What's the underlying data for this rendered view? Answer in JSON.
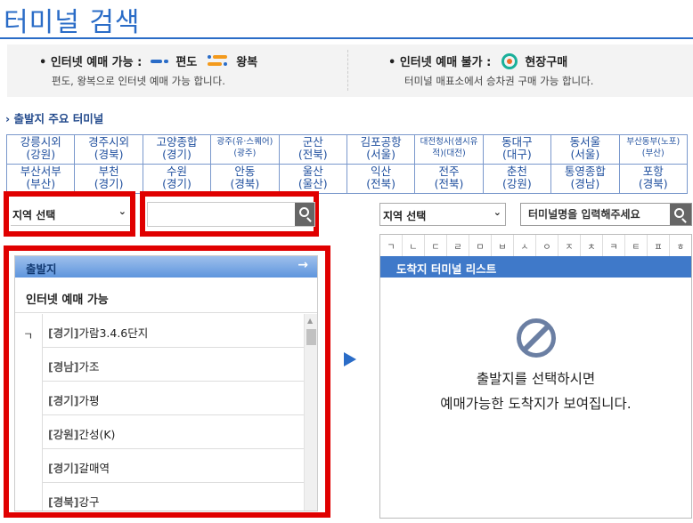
{
  "page_title": "터미널 검색",
  "legend": {
    "internet_ok": {
      "label": "• 인터넷 예매 가능 :",
      "oneway": "편도",
      "roundtrip": "왕복",
      "desc": "편도, 왕복으로 인터넷 예매 가능 합니다."
    },
    "internet_no": {
      "label": "• 인터넷 예매 불가 :",
      "onsite": "현장구매",
      "desc": "터미널 매표소에서 승차권 구매 가능 합니다."
    }
  },
  "colors": {
    "accent": "#2a6cc7",
    "oneway": "#2a6cc7",
    "roundtrip_a": "#2a6cc7",
    "roundtrip_b": "#f39a1c",
    "onsite_ring": "#1ab09a",
    "onsite_dot": "#f06b28",
    "highlight": "#e00000"
  },
  "section_title": "출발지 주요 터미널",
  "terminals": [
    [
      {
        "name": "강릉시외",
        "region": "(강원)"
      },
      {
        "name": "경주시외",
        "region": "(경북)"
      },
      {
        "name": "고양종합",
        "region": "(경기)"
      },
      {
        "name": "광주(유·스퀘어)",
        "region": "(광주)",
        "small": true
      },
      {
        "name": "군산",
        "region": "(전북)"
      },
      {
        "name": "김포공항",
        "region": "(서울)"
      },
      {
        "name": "대전청사(샘시유",
        "region": "적)(대전)",
        "small": true
      },
      {
        "name": "동대구",
        "region": "(대구)"
      },
      {
        "name": "동서울",
        "region": "(서울)"
      },
      {
        "name": "부산동부(노포)",
        "region": "(부산)",
        "small": true
      }
    ],
    [
      {
        "name": "부산서부",
        "region": "(부산)"
      },
      {
        "name": "부천",
        "region": "(경기)"
      },
      {
        "name": "수원",
        "region": "(경기)"
      },
      {
        "name": "안동",
        "region": "(경북)"
      },
      {
        "name": "울산",
        "region": "(울산)"
      },
      {
        "name": "익산",
        "region": "(전북)"
      },
      {
        "name": "전주",
        "region": "(전북)"
      },
      {
        "name": "춘천",
        "region": "(강원)"
      },
      {
        "name": "통영종합",
        "region": "(경남)"
      },
      {
        "name": "포항",
        "region": "(경북)"
      }
    ]
  ],
  "departure": {
    "region_select": "지역 선택",
    "search_value": "",
    "panel_title": "출발지",
    "panel_subtitle": "인터넷 예매 가능",
    "index_letter": "ㄱ",
    "items": [
      {
        "region": "[경기]",
        "name": "가람3.4.6단지"
      },
      {
        "region": "[경남]",
        "name": "가조"
      },
      {
        "region": "[경기]",
        "name": "가평"
      },
      {
        "region": "[강원]",
        "name": "간성(K)"
      },
      {
        "region": "[경기]",
        "name": "갈매역"
      },
      {
        "region": "[경북]",
        "name": "강구"
      }
    ]
  },
  "arrival": {
    "region_select": "지역 선택",
    "search_placeholder": "터미널명을 입력해주세요",
    "consonants": [
      "ㄱ",
      "ㄴ",
      "ㄷ",
      "ㄹ",
      "ㅁ",
      "ㅂ",
      "ㅅ",
      "ㅇ",
      "ㅈ",
      "ㅊ",
      "ㅋ",
      "ㅌ",
      "ㅍ",
      "ㅎ"
    ],
    "list_title": "도착지 터미널 리스트",
    "empty_line1": "출발지를 선택하시면",
    "empty_line2": "예매가능한 도착지가 보여집니다."
  }
}
